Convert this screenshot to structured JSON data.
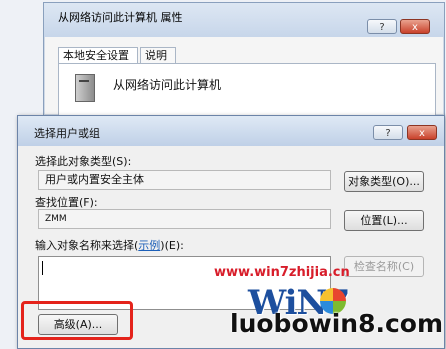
{
  "back_dialog": {
    "title": "从网络访问此计算机 属性",
    "help_button": "?",
    "close_button": "x",
    "tabs": [
      {
        "label": "本地安全设置",
        "active": true
      },
      {
        "label": "说明",
        "active": false
      }
    ],
    "object_name": "从网络访问此计算机"
  },
  "front_dialog": {
    "title": "选择用户或组",
    "help_button": "?",
    "close_button": "x",
    "object_type_label": "选择此对象类型(S):",
    "object_type_value": "用户或内置安全主体",
    "object_type_button": "对象类型(O)...",
    "location_label": "查找位置(F):",
    "location_value": "ZMM",
    "location_button": "位置(L)...",
    "names_label_prefix": "输入对象名称来选择(",
    "names_label_link": "示例",
    "names_label_suffix": ")(E):",
    "check_names_button": "检查名称(C)",
    "advanced_button": "高级(A)..."
  },
  "watermarks": {
    "url": "www.win7zhijia.cn",
    "logo": "WiN7",
    "site": "luobowin8.com"
  },
  "colors": {
    "highlight": "#e4231b",
    "link": "#1c5fb8"
  }
}
